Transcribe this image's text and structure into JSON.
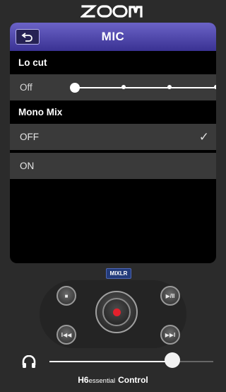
{
  "brand": {
    "logo_text": "ZOOM"
  },
  "header": {
    "title": "MIC",
    "back_icon": "back-arrow-icon"
  },
  "lo_cut": {
    "section_label": "Lo cut",
    "value": "Off",
    "slider_positions": 4,
    "slider_selected_index": 0
  },
  "mono_mix": {
    "section_label": "Mono Mix",
    "options": [
      {
        "label": "OFF",
        "selected": true
      },
      {
        "label": "ON",
        "selected": false
      }
    ],
    "check_glyph": "✓"
  },
  "transport": {
    "mixlr_label": "MIXLR",
    "stop_label": "■",
    "play_pause_label": "▶/II",
    "prev_label": "I◀◀",
    "next_label": "▶▶I",
    "record_color": "#e3202c"
  },
  "volume": {
    "level": 0.75,
    "icon": "headphone-icon"
  },
  "footer": {
    "model": "H6",
    "model_sub": "essential",
    "app": "Control"
  },
  "colors": {
    "title_bar": "#4a41ad",
    "background": "#2b2b2b",
    "row": "#3a3a3a",
    "record": "#e3202c"
  }
}
